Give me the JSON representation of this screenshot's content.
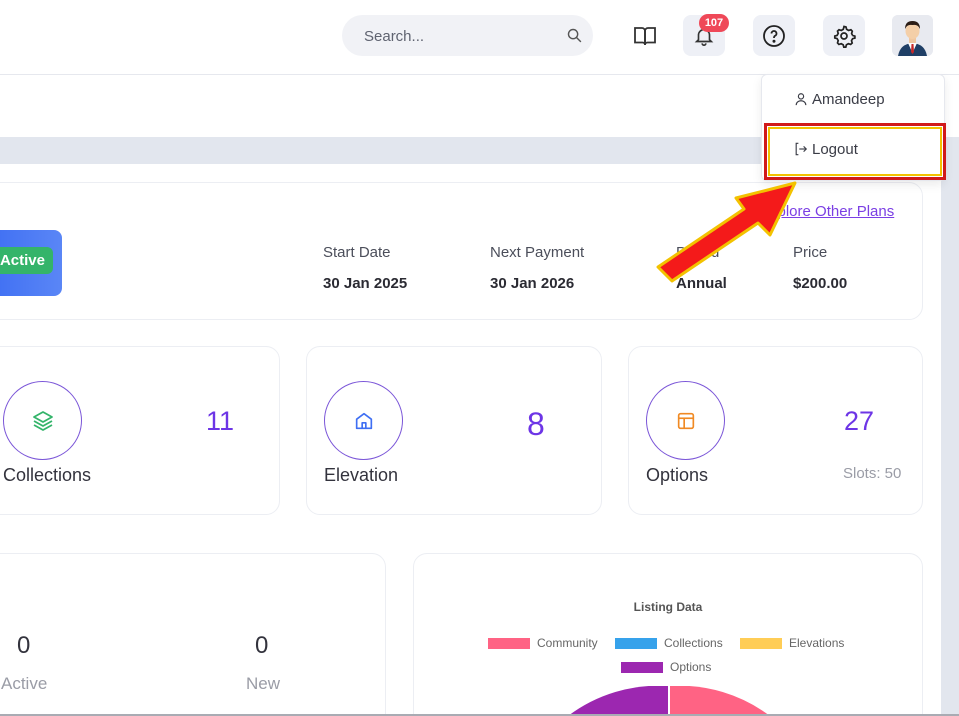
{
  "topbar": {
    "search_placeholder": "Search...",
    "notification_count": "107",
    "icons": [
      "search-icon",
      "book-icon",
      "bell-icon",
      "help-icon",
      "gear-icon",
      "avatar"
    ]
  },
  "user_menu": {
    "username": "Amandeep",
    "logout_label": "Logout"
  },
  "plan": {
    "status": "Active",
    "explore_link": "Explore Other Plans",
    "start_date_label": "Start Date",
    "start_date": "30 Jan 2025",
    "next_payment_label": "Next Payment",
    "next_payment": "30 Jan 2026",
    "period_label": "Period",
    "period": "Annual",
    "price_label": "Price",
    "price": "$200.00"
  },
  "stats": [
    {
      "label": "Collections",
      "value": "11",
      "icon": "layers-icon"
    },
    {
      "label": "Elevation",
      "value": "8",
      "icon": "home-icon"
    },
    {
      "label": "Options",
      "value": "27",
      "icon": "layout-icon",
      "extra": "Slots: 50"
    }
  ],
  "listing_summary": {
    "active_value": "0",
    "active_label": "Active",
    "new_value": "0",
    "new_label": "New"
  },
  "chart_data": {
    "type": "pie",
    "title": "Listing Data",
    "legend": [
      "Community",
      "Collections",
      "Elevations",
      "Options"
    ],
    "colors": [
      "#ff6384",
      "#36a2eb",
      "#ffcd56",
      "#9c27b0"
    ]
  },
  "colors": {
    "accent": "#6d35e6",
    "active_green": "#34b46a",
    "badge_red": "#ef4858",
    "highlight_red": "#d11a1a"
  }
}
